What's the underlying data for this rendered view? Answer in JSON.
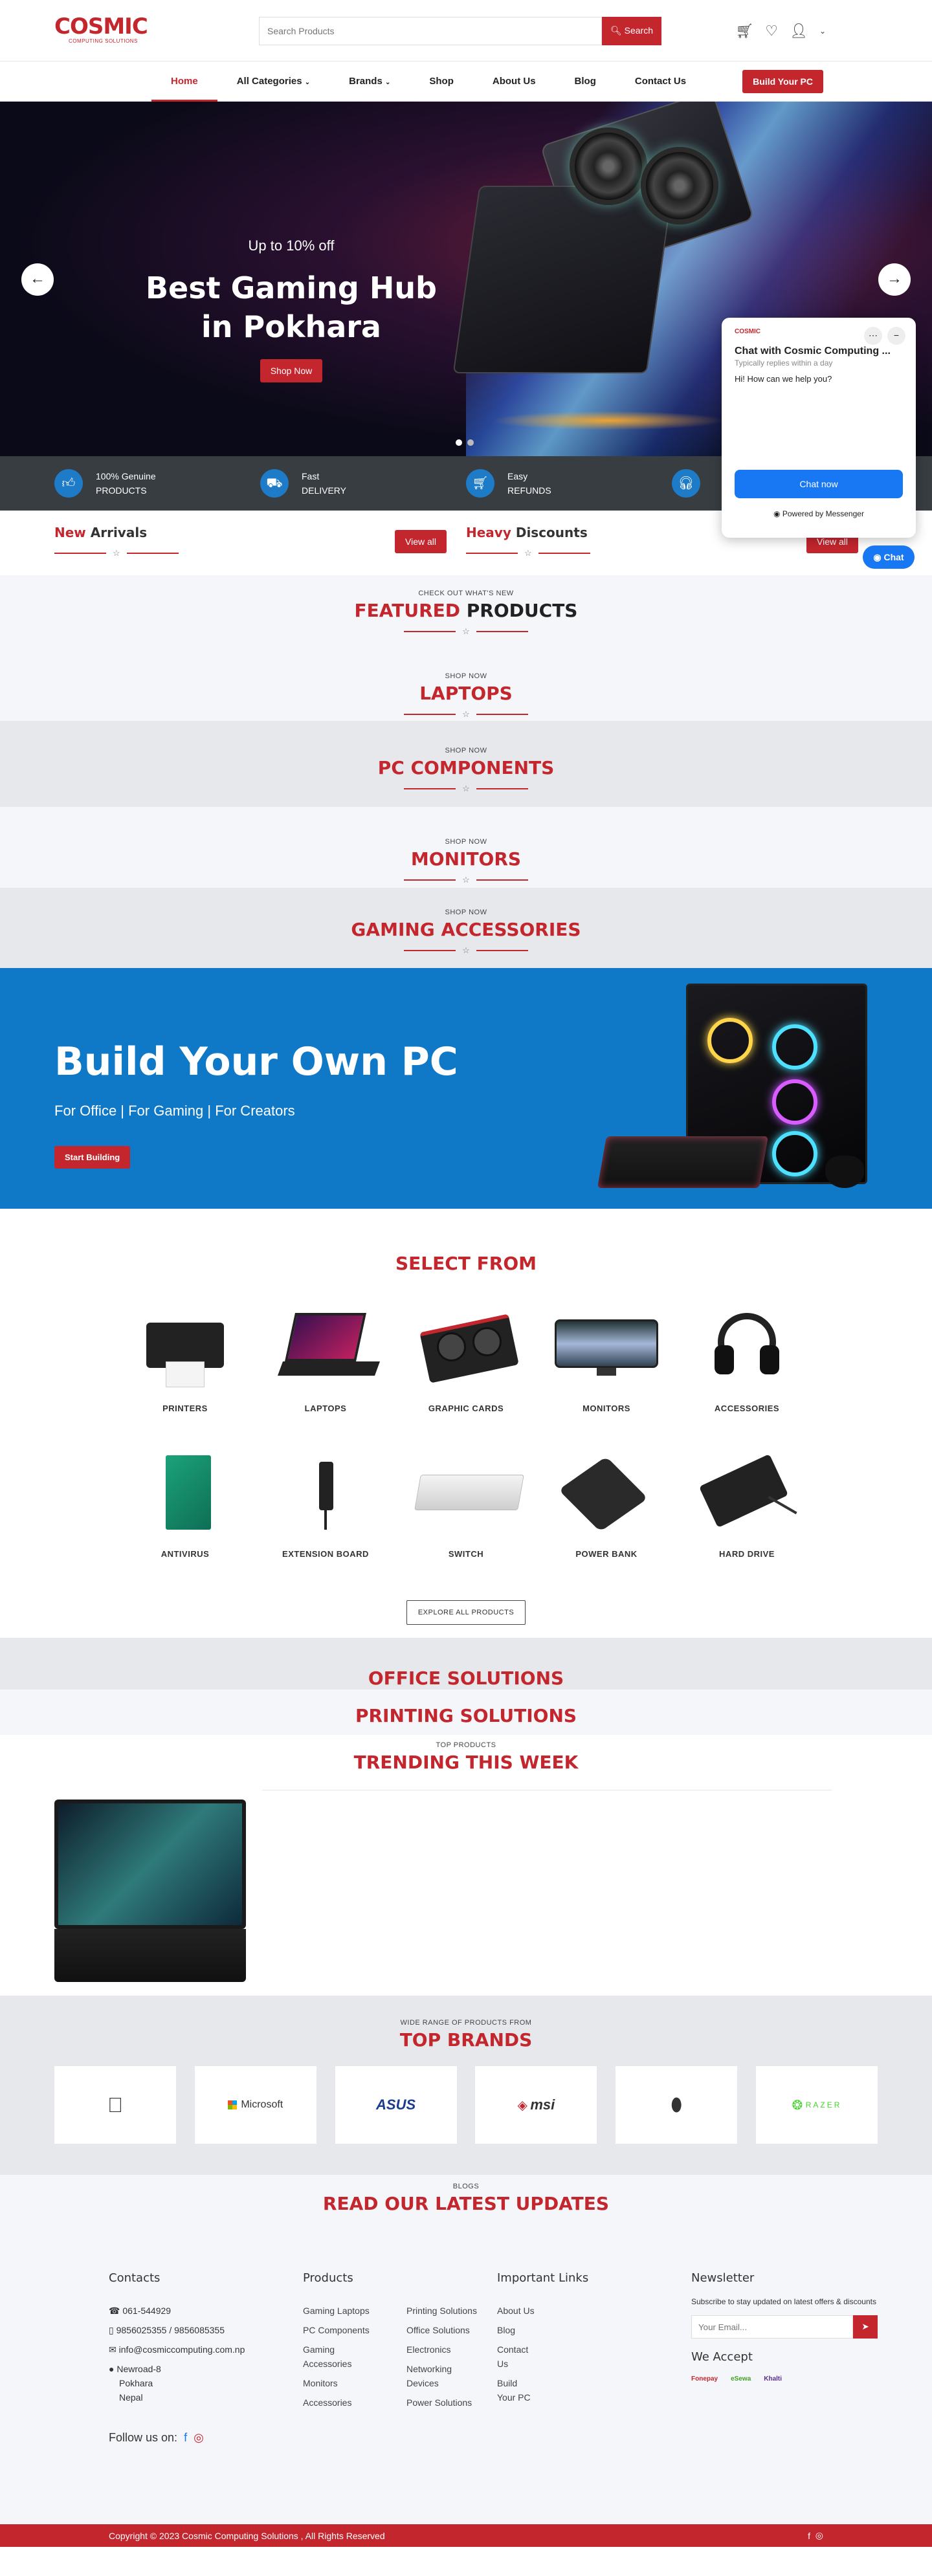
{
  "header": {
    "logo_name": "COSMIC",
    "logo_sub": "COMPUTING SOLUTIONS",
    "search_placeholder": "Search Products",
    "search_button": "Search",
    "icons": [
      "cart-icon",
      "heart-icon",
      "user-icon",
      "chevron-down-icon"
    ]
  },
  "nav": {
    "items": [
      "Home",
      "All Categories",
      "Brands",
      "Shop",
      "About Us",
      "Blog",
      "Contact Us"
    ],
    "active": "Home",
    "build_button": "Build Your PC"
  },
  "hero": {
    "eyebrow": "Up to 10% off",
    "title": "Best Gaming Hub in Pokhara",
    "button": "Shop Now",
    "slides": 2,
    "active_slide": 1
  },
  "features": [
    {
      "title": "100% Genuine",
      "sub": "PRODUCTS",
      "icon": "thumbs-up-icon"
    },
    {
      "title": "Fast",
      "sub": "DELIVERY",
      "icon": "truck-icon"
    },
    {
      "title": "Easy",
      "sub": "REFUNDS",
      "icon": "cart-icon"
    },
    {
      "title": "",
      "sub": "",
      "icon": "headset-icon"
    }
  ],
  "arrivals": {
    "accent": "New",
    "rest": "Arrivals",
    "button": "View all"
  },
  "discounts": {
    "accent": "Heavy",
    "rest": "Discounts",
    "button": "View all"
  },
  "sections": {
    "featured_small": "CHECK OUT WHAT'S NEW",
    "featured_accent": "FEATURED",
    "featured_rest": "PRODUCTS",
    "laptops_small": "SHOP NOW",
    "laptops": "LAPTOPS",
    "pc_small": "SHOP NOW",
    "pc": "PC COMPONENTS",
    "monitors_small": "SHOP NOW",
    "monitors": "MONITORS",
    "gaming_small": "SHOP NOW",
    "gaming": "GAMING ACCESSORIES"
  },
  "buildpc": {
    "title": "Build Your Own PC",
    "subtitle": "For Office | For Gaming | For Creators",
    "button": "Start Building"
  },
  "select": {
    "title": "SELECT FROM",
    "categories": [
      "PRINTERS",
      "LAPTOPS",
      "GRAPHIC CARDS",
      "MONITORS",
      "ACCESSORIES",
      "ANTIVIRUS",
      "EXTENSION BOARD",
      "SWITCH",
      "POWER BANK",
      "HARD DRIVE"
    ],
    "explore": "EXPLORE ALL PRODUCTS"
  },
  "office": "OFFICE SOLUTIONS",
  "printing": "PRINTING SOLUTIONS",
  "trending": {
    "small": "TOP PRODUCTS",
    "title": "TRENDING THIS WEEK"
  },
  "brands": {
    "small": "WIDE RANGE OF PRODUCTS FROM",
    "title": "TOP BRANDS",
    "list": [
      "",
      "Microsoft",
      "ASUS",
      "msi",
      "",
      "RAZER"
    ]
  },
  "blogs": {
    "small": "BLOGS",
    "title": "READ OUR LATEST UPDATES"
  },
  "footer": {
    "contacts": {
      "title": "Contacts",
      "phone": "061-544929",
      "mobile": "9856025355 / 9856085355",
      "email": "info@cosmiccomputing.com.np",
      "address1": "Newroad-8",
      "address2": "Pokhara",
      "address3": "Nepal"
    },
    "products": {
      "title": "Products",
      "col1": [
        "Gaming Laptops",
        "PC Components",
        "Gaming Accessories",
        "Monitors",
        "Accessories"
      ],
      "col2": [
        "Printing Solutions",
        "Office Solutions",
        "Electronics",
        "Networking Devices",
        "Power Solutions"
      ]
    },
    "links": {
      "title": "Important Links",
      "items": [
        "About Us",
        "Blog",
        "Contact Us",
        "Build Your PC"
      ]
    },
    "newsletter": {
      "title": "Newsletter",
      "text": "Subscribe to stay updated on latest offers & discounts",
      "placeholder": "Your Email...",
      "accept_title": "We Accept",
      "accept_items": [
        "Fonepay",
        "eSewa",
        "Khalti"
      ]
    },
    "follow": "Follow us on:"
  },
  "copyright": "Copyright © 2023 Cosmic Computing Solutions , All Rights Reserved",
  "messenger": {
    "logo": "COSMIC",
    "title": "Chat with Cosmic Computing ...",
    "status": "Typically replies within a day",
    "greeting": "Hi! How can we help you?",
    "button": "Chat now",
    "powered": "Powered by Messenger",
    "chat_label": "Chat"
  },
  "colors": {
    "brand_red": "#c4262e",
    "blue": "#0f79c7",
    "dark": "#383d42",
    "messenger_blue": "#1877f2"
  }
}
